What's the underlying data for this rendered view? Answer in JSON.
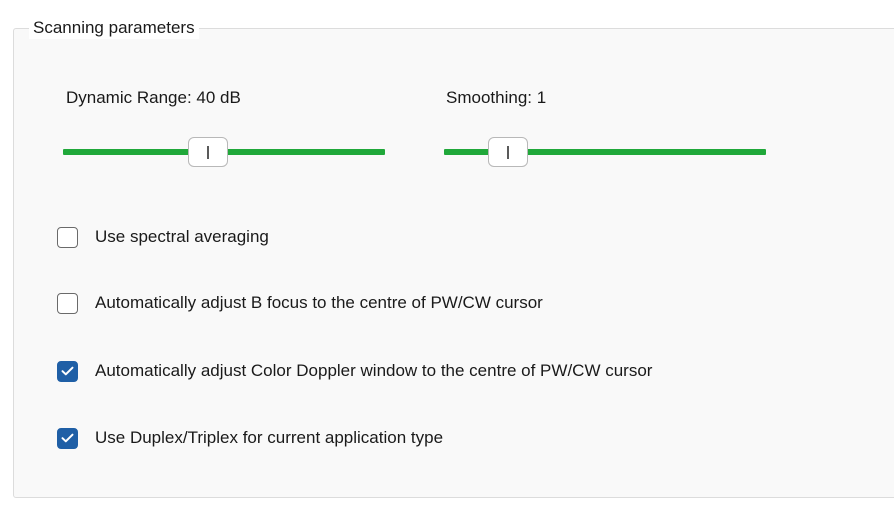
{
  "group": {
    "title": "Scanning parameters"
  },
  "sliders": [
    {
      "label": "Dynamic Range: 40 dB",
      "value_fraction": 0.45
    },
    {
      "label": "Smoothing: 1",
      "value_fraction": 0.2
    }
  ],
  "checkboxes": [
    {
      "label": "Use spectral averaging",
      "checked": false
    },
    {
      "label": "Automatically adjust B focus to the centre of PW/CW cursor",
      "checked": false
    },
    {
      "label": "Automatically adjust Color Doppler window to the centre of PW/CW cursor",
      "checked": true
    },
    {
      "label": "Use Duplex/Triplex for current application type",
      "checked": true
    }
  ],
  "colors": {
    "slider_track": "#20a83a",
    "checkbox_checked": "#1f5fa6"
  }
}
